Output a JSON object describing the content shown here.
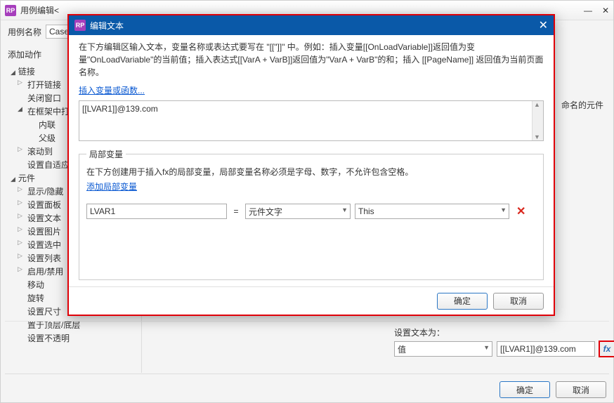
{
  "outer": {
    "title_prefix": "用例编辑<",
    "case_name_label": "用例名称",
    "case_name_value": "Case",
    "add_action_label": "添加动作",
    "tree": {
      "groups": [
        {
          "label": "链接",
          "items": [
            {
              "label": "打开链接",
              "caret": true
            },
            {
              "label": "关闭窗口"
            },
            {
              "label": "在框架中打开",
              "caret": true,
              "open": true,
              "children": [
                "内联",
                "父级"
              ]
            },
            {
              "label": "滚动到",
              "caret": true
            },
            {
              "label": "设置自适应"
            }
          ]
        },
        {
          "label": "元件",
          "items": [
            {
              "label": "显示/隐藏",
              "caret": true
            },
            {
              "label": "设置面板",
              "caret": true
            },
            {
              "label": "设置文本",
              "caret": true
            },
            {
              "label": "设置图片",
              "caret": true
            },
            {
              "label": "设置选中",
              "caret": true
            },
            {
              "label": "设置列表",
              "caret": true
            },
            {
              "label": "启用/禁用",
              "caret": true
            },
            {
              "label": "移动"
            },
            {
              "label": "旋转"
            },
            {
              "label": "设置尺寸"
            },
            {
              "label": "置于顶层/底层"
            },
            {
              "label": "设置不透明"
            }
          ]
        }
      ]
    },
    "right_placeholder": "命名的元件",
    "set_text_label": "设置文本为：",
    "set_text_mode": "值",
    "set_text_value": "[[LVAR1]]@139.com",
    "fx_label": "fx",
    "ok": "确定",
    "cancel": "取消"
  },
  "modal": {
    "title": "编辑文本",
    "desc": "在下方编辑区输入文本，变量名称或表达式要写在 \"[[\"]]\" 中。例如：插入变量[[OnLoadVariable]]返回值为变量\"OnLoadVariable\"的当前值；插入表达式[[VarA + VarB]]返回值为\"VarA + VarB\"的和；插入 [[PageName]] 返回值为当前页面名称。",
    "insert_link": "插入变量或函数...",
    "text_value": "[[LVAR1]]@139.com",
    "local_var_legend": "局部变量",
    "local_var_desc": "在下方创建用于插入fx的局部变量，局部变量名称必须是字母、数字，不允许包含空格。",
    "add_var_link": "添加局部变量",
    "var_name": "LVAR1",
    "var_source": "元件文字",
    "var_target": "This",
    "ok": "确定",
    "cancel": "取消"
  }
}
